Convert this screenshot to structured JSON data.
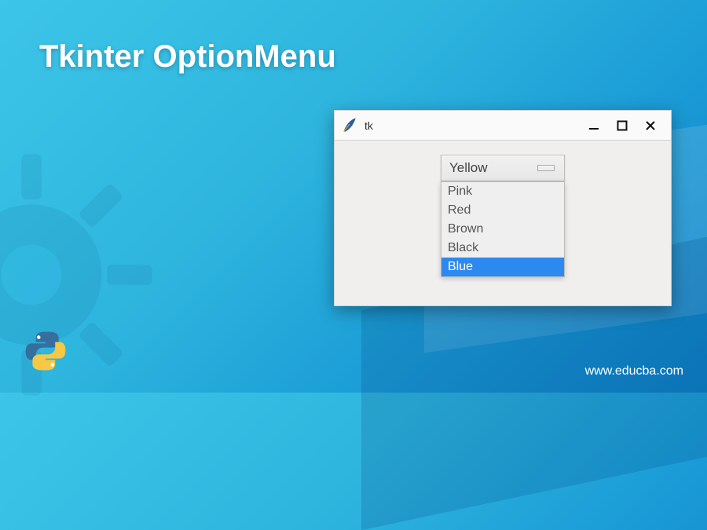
{
  "title": "Tkinter OptionMenu",
  "watermark": "www.educba.com",
  "tk_window": {
    "title": "tk",
    "option_selected": "Yellow",
    "menu_items": [
      "Pink",
      "Red",
      "Brown",
      "Black",
      "Blue"
    ],
    "highlighted_item": "Blue"
  }
}
